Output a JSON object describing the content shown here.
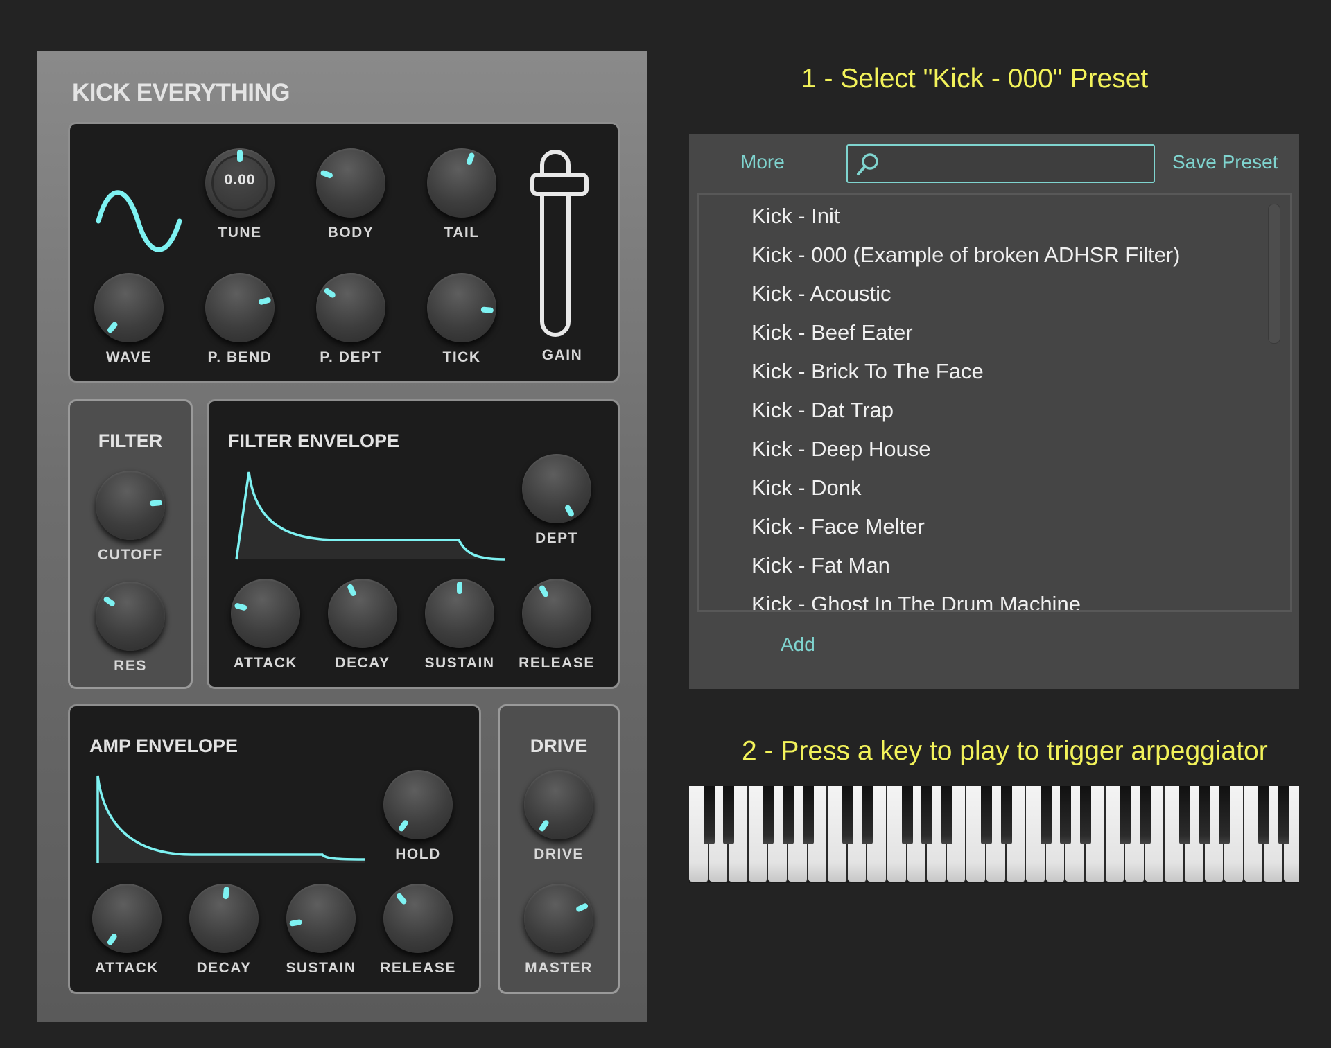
{
  "plugin": {
    "title": "KICK EVERYTHING",
    "osc": {
      "wave_icon": "sine-wave-icon",
      "tune_value": "0.00",
      "labels": {
        "tune": "TUNE",
        "body": "BODY",
        "tail": "TAIL",
        "wave": "WAVE",
        "pbend": "P. BEND",
        "pdept": "P. DEPT",
        "tick": "TICK",
        "gain": "GAIN"
      }
    },
    "filter": {
      "title": "FILTER",
      "cutoff": "CUTOFF",
      "res": "RES"
    },
    "filter_env": {
      "title": "FILTER ENVELOPE",
      "dept": "DEPT",
      "attack": "ATTACK",
      "decay": "DECAY",
      "sustain": "SUSTAIN",
      "release": "RELEASE"
    },
    "amp_env": {
      "title": "AMP ENVELOPE",
      "hold": "HOLD",
      "attack": "ATTACK",
      "decay": "DECAY",
      "sustain": "SUSTAIN",
      "release": "RELEASE"
    },
    "drive": {
      "title": "DRIVE",
      "drive": "DRIVE",
      "master": "MASTER"
    }
  },
  "instructions": {
    "step1": "1 - Select \"Kick - 000\" Preset",
    "step2": "2 - Press a key to play to trigger arpeggiator"
  },
  "browser": {
    "more_label": "More",
    "save_label": "Save Preset",
    "add_label": "Add",
    "search_value": "",
    "search_icon": "search-icon",
    "presets": [
      "Kick - Init",
      "Kick - 000 (Example of broken ADHSR Filter)",
      "Kick - Acoustic",
      "Kick - Beef Eater",
      "Kick - Brick To The Face",
      "Kick - Dat Trap",
      "Kick - Deep House",
      "Kick - Donk",
      "Kick - Face Melter",
      "Kick - Fat Man",
      "Kick - Ghost In The Drum Machine"
    ]
  },
  "colors": {
    "accent": "#7ef2f2",
    "link": "#7fd4cf",
    "instruction": "#f2f25a"
  }
}
